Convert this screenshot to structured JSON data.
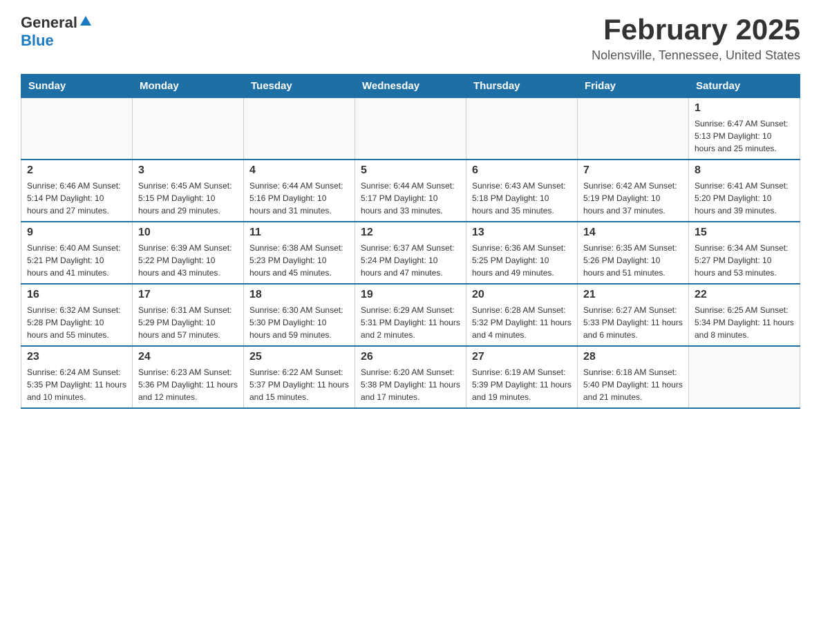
{
  "header": {
    "logo_general": "General",
    "logo_blue": "Blue",
    "month_title": "February 2025",
    "location": "Nolensville, Tennessee, United States"
  },
  "days_of_week": [
    "Sunday",
    "Monday",
    "Tuesday",
    "Wednesday",
    "Thursday",
    "Friday",
    "Saturday"
  ],
  "weeks": [
    [
      {
        "day": "",
        "info": ""
      },
      {
        "day": "",
        "info": ""
      },
      {
        "day": "",
        "info": ""
      },
      {
        "day": "",
        "info": ""
      },
      {
        "day": "",
        "info": ""
      },
      {
        "day": "",
        "info": ""
      },
      {
        "day": "1",
        "info": "Sunrise: 6:47 AM\nSunset: 5:13 PM\nDaylight: 10 hours and 25 minutes."
      }
    ],
    [
      {
        "day": "2",
        "info": "Sunrise: 6:46 AM\nSunset: 5:14 PM\nDaylight: 10 hours and 27 minutes."
      },
      {
        "day": "3",
        "info": "Sunrise: 6:45 AM\nSunset: 5:15 PM\nDaylight: 10 hours and 29 minutes."
      },
      {
        "day": "4",
        "info": "Sunrise: 6:44 AM\nSunset: 5:16 PM\nDaylight: 10 hours and 31 minutes."
      },
      {
        "day": "5",
        "info": "Sunrise: 6:44 AM\nSunset: 5:17 PM\nDaylight: 10 hours and 33 minutes."
      },
      {
        "day": "6",
        "info": "Sunrise: 6:43 AM\nSunset: 5:18 PM\nDaylight: 10 hours and 35 minutes."
      },
      {
        "day": "7",
        "info": "Sunrise: 6:42 AM\nSunset: 5:19 PM\nDaylight: 10 hours and 37 minutes."
      },
      {
        "day": "8",
        "info": "Sunrise: 6:41 AM\nSunset: 5:20 PM\nDaylight: 10 hours and 39 minutes."
      }
    ],
    [
      {
        "day": "9",
        "info": "Sunrise: 6:40 AM\nSunset: 5:21 PM\nDaylight: 10 hours and 41 minutes."
      },
      {
        "day": "10",
        "info": "Sunrise: 6:39 AM\nSunset: 5:22 PM\nDaylight: 10 hours and 43 minutes."
      },
      {
        "day": "11",
        "info": "Sunrise: 6:38 AM\nSunset: 5:23 PM\nDaylight: 10 hours and 45 minutes."
      },
      {
        "day": "12",
        "info": "Sunrise: 6:37 AM\nSunset: 5:24 PM\nDaylight: 10 hours and 47 minutes."
      },
      {
        "day": "13",
        "info": "Sunrise: 6:36 AM\nSunset: 5:25 PM\nDaylight: 10 hours and 49 minutes."
      },
      {
        "day": "14",
        "info": "Sunrise: 6:35 AM\nSunset: 5:26 PM\nDaylight: 10 hours and 51 minutes."
      },
      {
        "day": "15",
        "info": "Sunrise: 6:34 AM\nSunset: 5:27 PM\nDaylight: 10 hours and 53 minutes."
      }
    ],
    [
      {
        "day": "16",
        "info": "Sunrise: 6:32 AM\nSunset: 5:28 PM\nDaylight: 10 hours and 55 minutes."
      },
      {
        "day": "17",
        "info": "Sunrise: 6:31 AM\nSunset: 5:29 PM\nDaylight: 10 hours and 57 minutes."
      },
      {
        "day": "18",
        "info": "Sunrise: 6:30 AM\nSunset: 5:30 PM\nDaylight: 10 hours and 59 minutes."
      },
      {
        "day": "19",
        "info": "Sunrise: 6:29 AM\nSunset: 5:31 PM\nDaylight: 11 hours and 2 minutes."
      },
      {
        "day": "20",
        "info": "Sunrise: 6:28 AM\nSunset: 5:32 PM\nDaylight: 11 hours and 4 minutes."
      },
      {
        "day": "21",
        "info": "Sunrise: 6:27 AM\nSunset: 5:33 PM\nDaylight: 11 hours and 6 minutes."
      },
      {
        "day": "22",
        "info": "Sunrise: 6:25 AM\nSunset: 5:34 PM\nDaylight: 11 hours and 8 minutes."
      }
    ],
    [
      {
        "day": "23",
        "info": "Sunrise: 6:24 AM\nSunset: 5:35 PM\nDaylight: 11 hours and 10 minutes."
      },
      {
        "day": "24",
        "info": "Sunrise: 6:23 AM\nSunset: 5:36 PM\nDaylight: 11 hours and 12 minutes."
      },
      {
        "day": "25",
        "info": "Sunrise: 6:22 AM\nSunset: 5:37 PM\nDaylight: 11 hours and 15 minutes."
      },
      {
        "day": "26",
        "info": "Sunrise: 6:20 AM\nSunset: 5:38 PM\nDaylight: 11 hours and 17 minutes."
      },
      {
        "day": "27",
        "info": "Sunrise: 6:19 AM\nSunset: 5:39 PM\nDaylight: 11 hours and 19 minutes."
      },
      {
        "day": "28",
        "info": "Sunrise: 6:18 AM\nSunset: 5:40 PM\nDaylight: 11 hours and 21 minutes."
      },
      {
        "day": "",
        "info": ""
      }
    ]
  ]
}
